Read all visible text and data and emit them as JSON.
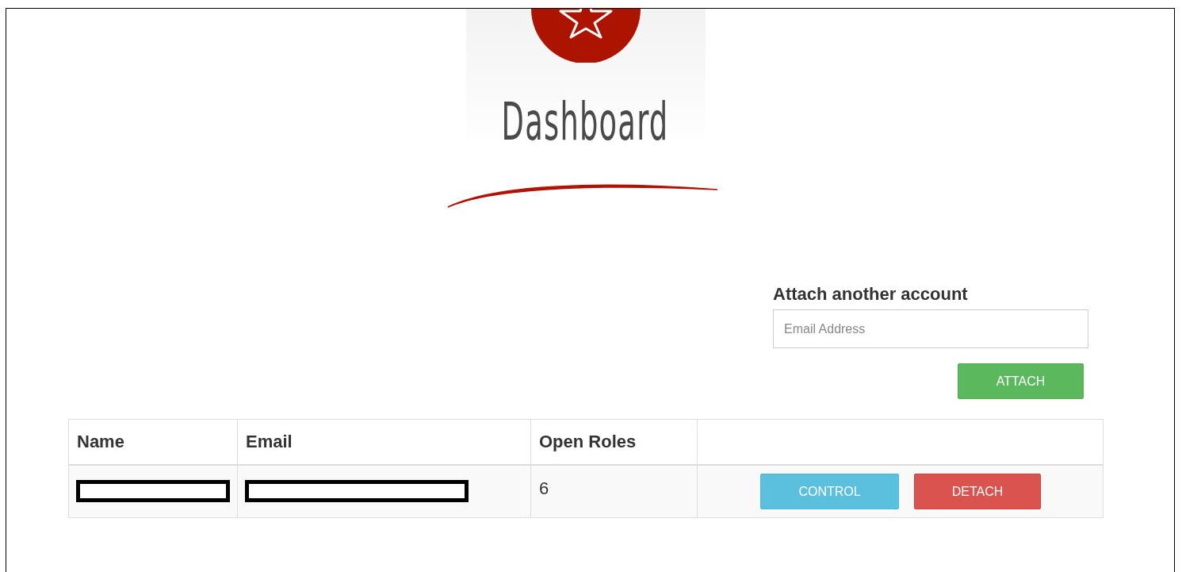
{
  "header": {
    "title": "Dashboard"
  },
  "attach_form": {
    "heading": "Attach another account",
    "email_field": {
      "placeholder": "Email Address"
    },
    "button": "ATTACH"
  },
  "table": {
    "columns": [
      "Name",
      "Email",
      "Open Roles",
      ""
    ],
    "rows": [
      {
        "cells": [
          {
            "kind": "redacted"
          },
          {
            "kind": "redacted"
          },
          {
            "kind": "text",
            "text": "6"
          },
          {
            "kind": "actions",
            "buttons": [
              {
                "label": "CONTROL",
                "kind": "info"
              },
              {
                "label": "DETACH",
                "kind": "danger"
              }
            ]
          }
        ]
      }
    ]
  }
}
